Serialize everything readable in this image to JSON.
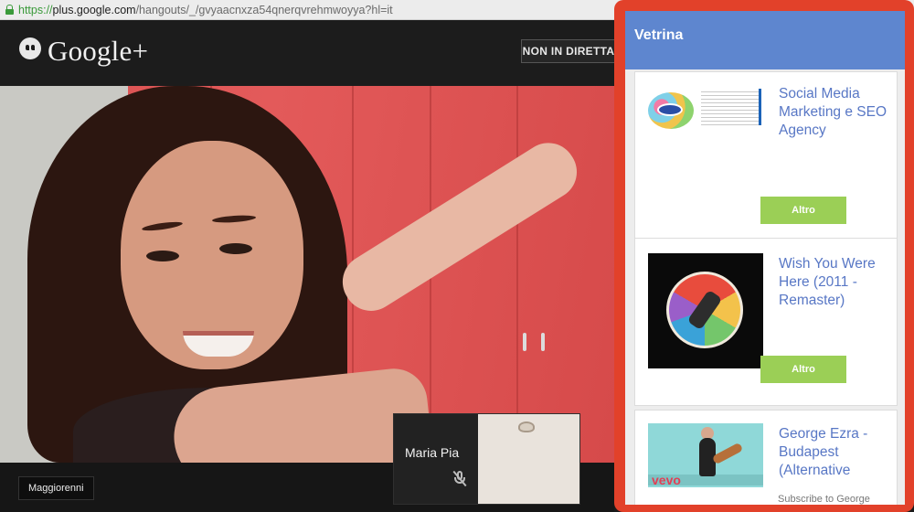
{
  "browser": {
    "url_scheme": "https://",
    "url_host": "plus.google.com",
    "url_path": "/hangouts/_/gvyaacnxza54qnerqvrehmwoyya?hl=it"
  },
  "hangout": {
    "logo_text": "Google+",
    "status_button": "NON IN DIRETTA",
    "bottom_label": "Maggiorenni",
    "participant_name": "Maria Pia"
  },
  "panel": {
    "title": "Vetrina",
    "items": [
      {
        "title": "Social Media Marketing e SEO Agency",
        "button": "Altro"
      },
      {
        "title": "Wish You Were Here (2011 - Remaster)",
        "button": "Altro"
      },
      {
        "title": "George Ezra - Budapest (Alternative",
        "extra": "Subscribe to George"
      }
    ],
    "thumb3_logo": "vevo"
  },
  "colors": {
    "panel_border": "#e2412a",
    "panel_header": "#5e86cf",
    "link_text": "#5877c5",
    "button_green": "#9bcf56"
  }
}
